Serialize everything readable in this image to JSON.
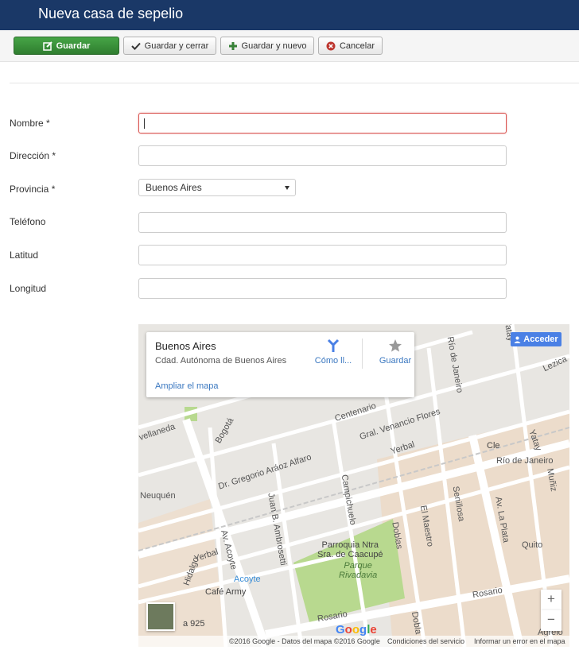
{
  "header": {
    "title": "Nueva casa de sepelio"
  },
  "toolbar": {
    "save": "Guardar",
    "save_close": "Guardar y cerrar",
    "save_new": "Guardar y nuevo",
    "cancel": "Cancelar"
  },
  "form": {
    "nombre": {
      "label": "Nombre *",
      "value": ""
    },
    "direccion": {
      "label": "Dirección *",
      "value": ""
    },
    "provincia": {
      "label": "Provincia *",
      "value": "Buenos Aires"
    },
    "telefono": {
      "label": "Teléfono",
      "value": ""
    },
    "latitud": {
      "label": "Latitud",
      "value": ""
    },
    "longitud": {
      "label": "Longitud",
      "value": ""
    }
  },
  "map": {
    "card": {
      "title": "Buenos Aires",
      "subtitle": "Cdad. Autónoma de Buenos Aires",
      "directions": "Cómo ll...",
      "save": "Guardar",
      "enlarge": "Ampliar el mapa"
    },
    "signin": "Acceder",
    "zoom_in": "+",
    "zoom_out": "−",
    "streets": {
      "bogota": "Bogotá",
      "avellaneda": "vellaneda",
      "centenario": "Centenario",
      "venancio": "Gral. Venancio Flores",
      "araoz": "Dr. Gregorio Aráoz Alfaro",
      "yerbal": "Yerbal",
      "yerbal2": "Yerbal",
      "neuquen": "Neuquén",
      "ambrosetti": "Juan B. Ambrosetti",
      "campichuelo": "Campichuelo",
      "maestro": "El Maestro",
      "senillosa": "Senillosa",
      "rio_janeiro": "Río de Janeiro",
      "rio_janeiro2": "Río de Janeiro",
      "yatay": "Yatay",
      "yatay2": "Yatay",
      "lezica": "Lezica",
      "munoz": "Muñiz",
      "acoyte": "Av. Acoyte",
      "la_plata": "Av. La Plata",
      "dobias": "Doblas",
      "dobias2": "Dobla",
      "quito": "Quito",
      "rosario": "Rosario",
      "rosario2": "Rosario",
      "hidalgo": "Hidalgo",
      "agrelo": "Agrelo",
      "parque": "Parque\nRivadavia",
      "parroquia": "Parroquia Ntra\nSra. de Caacupé",
      "acoyte_stn": "Acoyte",
      "cafe": "Café Army",
      "cle": "Cle",
      "num925": "a 925"
    },
    "footer": {
      "copyright": "©2016 Google - Datos del mapa ©2016 Google",
      "terms": "Condiciones del servicio",
      "report": "Informar un error en el mapa"
    },
    "logo": "Google"
  }
}
